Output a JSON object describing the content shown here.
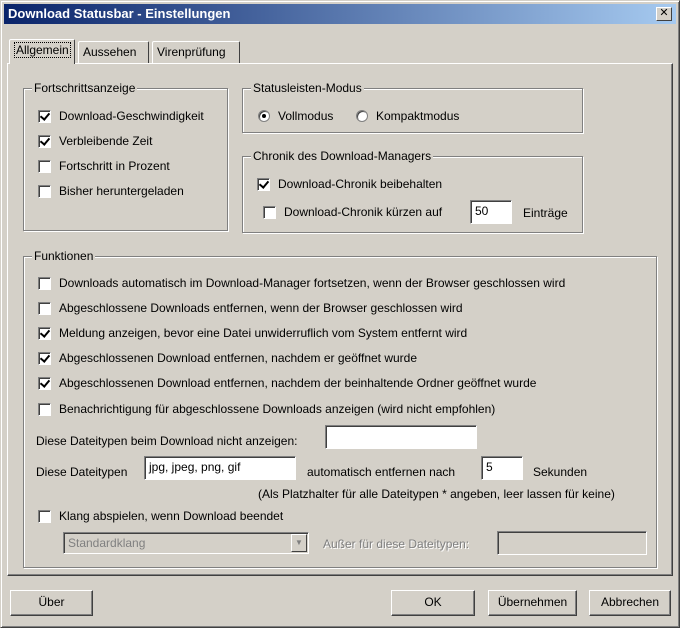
{
  "window": {
    "title": "Download Statusbar - Einstellungen",
    "close_glyph": "✕"
  },
  "tabs": [
    {
      "label": "Allgemein",
      "active": true
    },
    {
      "label": "Aussehen",
      "active": false
    },
    {
      "label": "Virenprüfung",
      "active": false
    }
  ],
  "progress_group": {
    "title": "Fortschrittsanzeige",
    "items": [
      {
        "label": "Download-Geschwindigkeit",
        "checked": true
      },
      {
        "label": "Verbleibende Zeit",
        "checked": true
      },
      {
        "label": "Fortschritt in Prozent",
        "checked": false
      },
      {
        "label": "Bisher heruntergeladen",
        "checked": false
      }
    ]
  },
  "mode_group": {
    "title": "Statusleisten-Modus",
    "options": [
      {
        "label": "Vollmodus",
        "selected": true
      },
      {
        "label": "Kompaktmodus",
        "selected": false
      }
    ]
  },
  "history_group": {
    "title": "Chronik des Download-Managers",
    "keep": {
      "label": "Download-Chronik beibehalten",
      "checked": true
    },
    "trim": {
      "label": "Download-Chronik kürzen auf",
      "checked": false,
      "value": "50",
      "suffix": "Einträge"
    }
  },
  "functions_group": {
    "title": "Funktionen",
    "items": [
      {
        "label": "Downloads automatisch im Download-Manager fortsetzen, wenn der Browser geschlossen wird",
        "checked": false
      },
      {
        "label": "Abgeschlossene Downloads entfernen, wenn der Browser geschlossen wird",
        "checked": false
      },
      {
        "label": "Meldung anzeigen, bevor eine Datei unwiderruflich vom System entfernt wird",
        "checked": true
      },
      {
        "label": "Abgeschlossenen Download entfernen, nachdem er geöffnet wurde",
        "checked": true
      },
      {
        "label": "Abgeschlossenen Download entfernen, nachdem der beinhaltende Ordner geöffnet wurde",
        "checked": true
      },
      {
        "label": "Benachrichtigung für abgeschlossene Downloads anzeigen (wird nicht empfohlen)",
        "checked": false
      }
    ],
    "ignore_types": {
      "label": "Diese Dateitypen beim Download nicht anzeigen:",
      "value": ""
    },
    "auto_remove": {
      "label_prefix": "Diese Dateitypen",
      "types_value": "jpg, jpeg, png, gif",
      "label_middle": "automatisch entfernen nach",
      "seconds_value": "5",
      "label_suffix": "Sekunden",
      "hint": "(Als Platzhalter für alle Dateitypen * angeben, leer lassen für keine)"
    },
    "sound": {
      "label": "Klang abspielen, wenn Download beendet",
      "checked": false,
      "select_value": "Standardklang",
      "except_label": "Außer für diese Dateitypen:",
      "except_value": ""
    }
  },
  "buttons": {
    "about": "Über",
    "ok": "OK",
    "apply": "Übernehmen",
    "cancel": "Abbrechen"
  }
}
